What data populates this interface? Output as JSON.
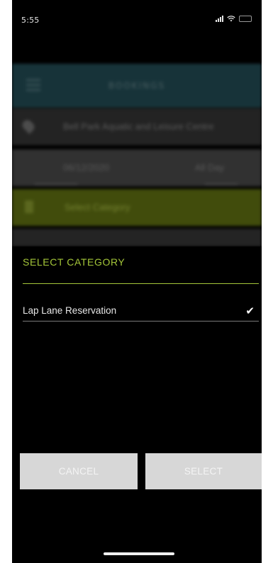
{
  "status_bar": {
    "time": "5:55"
  },
  "background_screen": {
    "title": "BOOKINGS",
    "location": "Bell Park Aquatic and Leisure Centre",
    "date": "06/12/2020",
    "time": "All Day",
    "category": "Select Category"
  },
  "picker": {
    "title": "SELECT CATEGORY",
    "options": [
      {
        "label": "Lap Lane Reservation",
        "selected": true
      }
    ],
    "cancel_label": "CANCEL",
    "select_label": "SELECT"
  },
  "colors": {
    "accent": "#a4c639",
    "button_bg": "#d7d7d7",
    "background": "#000000"
  }
}
